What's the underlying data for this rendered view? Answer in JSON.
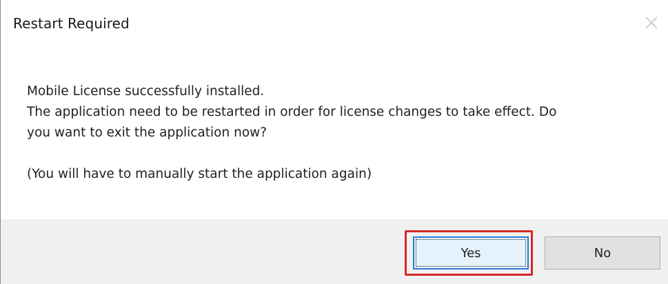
{
  "window": {
    "title": "Restart Required",
    "close_icon": "close-icon"
  },
  "message": {
    "line1": "Mobile License successfully installed.",
    "line2": "The application need to be restarted in order for license changes to take effect. Do",
    "line3": "you want to exit the application now?",
    "line4": "(You will have to manually start the application again)"
  },
  "buttons": {
    "yes_label": "Yes",
    "no_label": "No",
    "highlight_color": "#d62828"
  }
}
